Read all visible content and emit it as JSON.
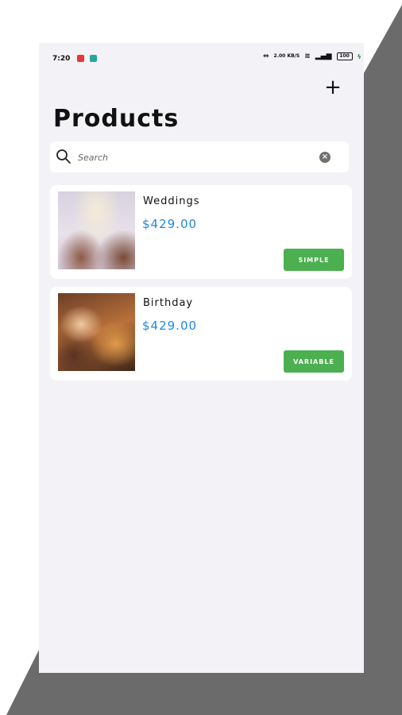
{
  "status_bar": {
    "time": "7:20",
    "network_speed": "2.00 KB/S",
    "battery": "100"
  },
  "header": {
    "title": "Products",
    "add_icon": "plus-icon"
  },
  "search": {
    "placeholder": "Search",
    "value": "",
    "search_icon": "search-icon",
    "clear_icon": "clear-icon"
  },
  "products": [
    {
      "name": "Weddings",
      "price": "$429.00",
      "type_label": "SIMPLE"
    },
    {
      "name": "Birthday",
      "price": "$429.00",
      "type_label": "VARIABLE"
    }
  ],
  "colors": {
    "background": "#f2f2f7",
    "card": "#ffffff",
    "price": "#1e88e5",
    "button": "#4caf50",
    "frame_shape": "#6b6b6b"
  }
}
